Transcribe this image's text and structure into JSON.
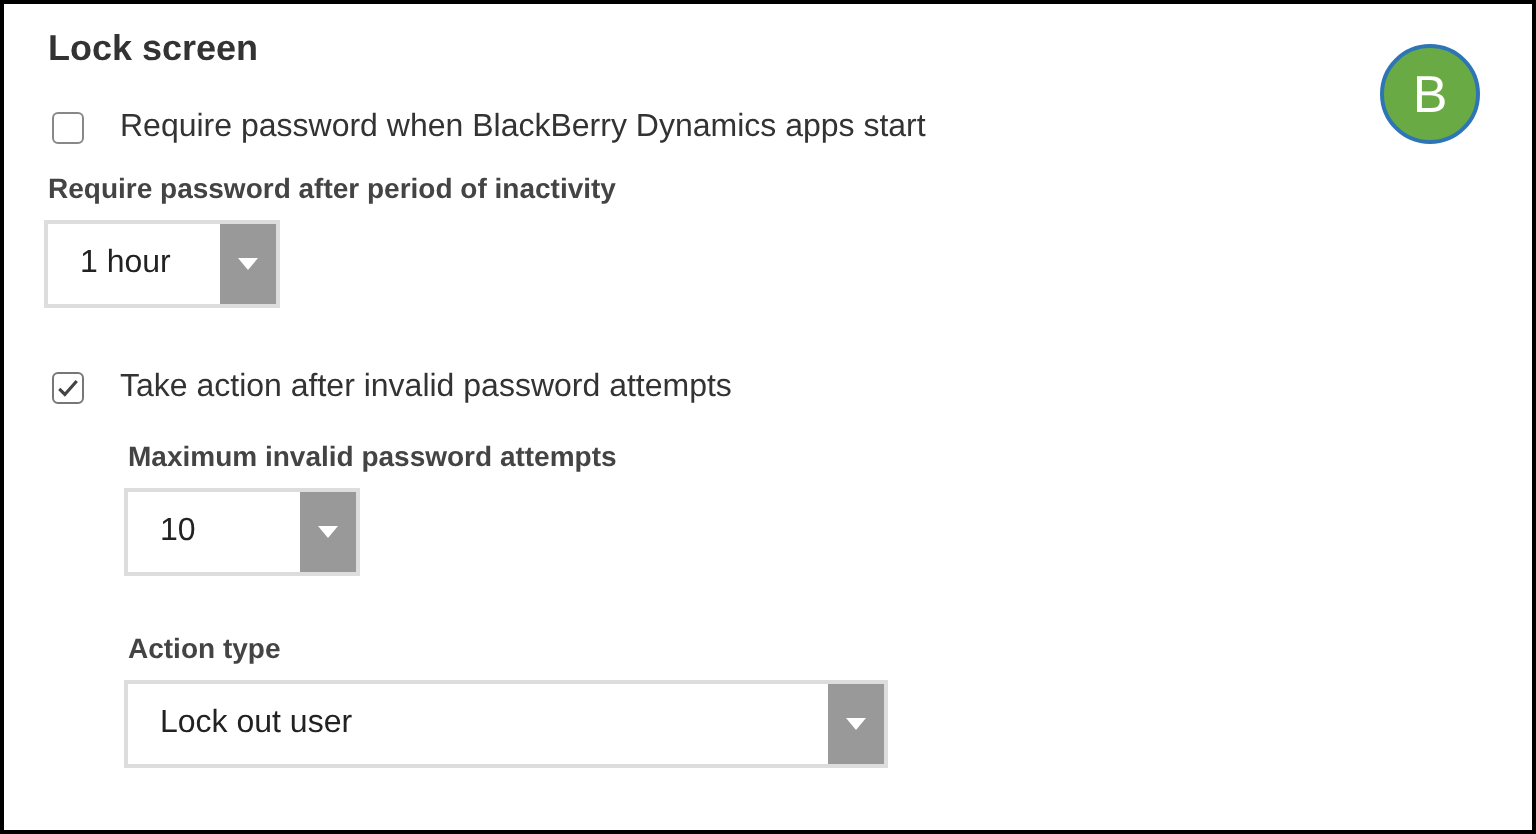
{
  "title": "Lock screen",
  "badge": "B",
  "items": [
    {
      "kind": "checkbox",
      "label": "Require password when BlackBerry Dynamics apps start",
      "checked": false
    },
    {
      "kind": "select",
      "label": "Require password after period of inactivity",
      "value": "1 hour"
    },
    {
      "kind": "checkbox",
      "label": "Take action after invalid password attempts",
      "checked": true,
      "children": [
        {
          "kind": "select",
          "label": "Maximum invalid password attempts",
          "value": "10"
        },
        {
          "kind": "select",
          "label": "Action type",
          "value": "Lock out user"
        }
      ]
    }
  ]
}
